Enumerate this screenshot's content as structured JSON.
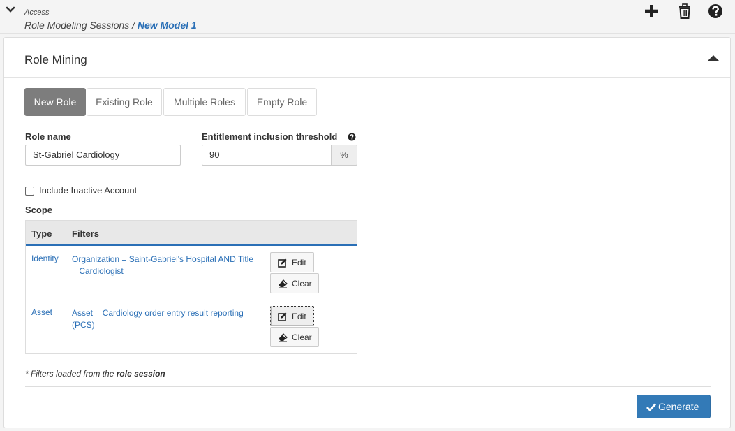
{
  "breadcrumb": {
    "section": "Access",
    "parent": "Role Modeling Sessions",
    "separator": " / ",
    "current": "New Model 1"
  },
  "toolbar": {
    "icons": [
      "chevron-down-icon",
      "plus-icon",
      "trash-icon",
      "question-icon"
    ]
  },
  "panel": {
    "title": "Role Mining"
  },
  "tabs": [
    {
      "label": "New Role",
      "active": true
    },
    {
      "label": "Existing Role",
      "active": false
    },
    {
      "label": "Multiple Roles",
      "active": false
    },
    {
      "label": "Empty Role",
      "active": false
    }
  ],
  "form": {
    "role_name_label": "Role name",
    "role_name_value": "St-Gabriel Cardiology",
    "threshold_label": "Entitlement inclusion threshold",
    "threshold_value": "90",
    "threshold_unit": "%",
    "include_inactive_label": "Include Inactive Account",
    "include_inactive_checked": false,
    "scope_label": "Scope"
  },
  "scope_table": {
    "headers": [
      "Type",
      "Filters"
    ],
    "rows": [
      {
        "type": "Identity",
        "filter": "Organization = Saint-Gabriel's Hospital AND Title = Cardiologist",
        "edit": "Edit",
        "clear": "Clear"
      },
      {
        "type": "Asset",
        "filter": "Asset = Cardiology order entry result reporting (PCS)",
        "edit": "Edit",
        "clear": "Clear"
      }
    ]
  },
  "footnote": {
    "prefix": "* Filters loaded from the ",
    "emphasis": "role session"
  },
  "actions": {
    "generate_label": "Generate"
  },
  "colors": {
    "accent": "#2a6fb6",
    "primary_button": "#337ab7",
    "active_tab": "#7d7d7d"
  }
}
